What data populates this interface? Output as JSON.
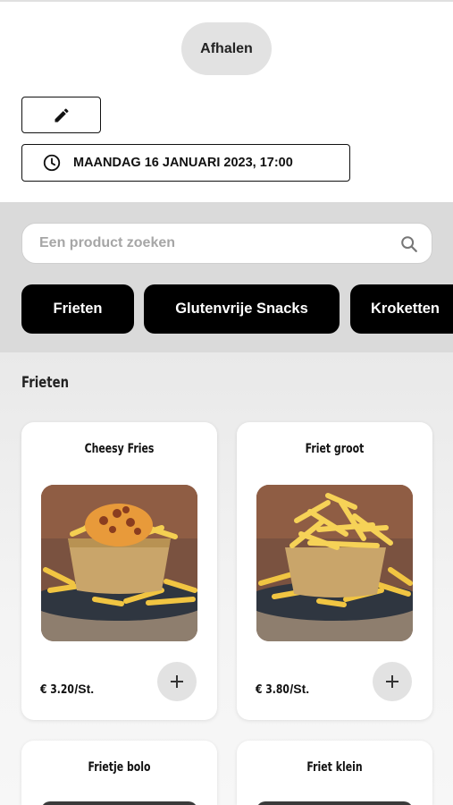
{
  "header": {
    "order_type": "Afhalen",
    "edit_icon": "pencil-icon",
    "datetime": "MAANDAG 16 JANUARI 2023, 17:00",
    "datetime_icon": "clock-icon"
  },
  "search": {
    "placeholder": "Een product zoeken",
    "icon": "search-icon"
  },
  "categories": [
    {
      "label": "Frieten"
    },
    {
      "label": "Glutenvrije Snacks"
    },
    {
      "label": "Kroketten"
    }
  ],
  "section": {
    "title": "Frieten"
  },
  "products": [
    {
      "name": "Cheesy Fries",
      "price": "€ 3.20",
      "unit": "/St."
    },
    {
      "name": "Friet groot",
      "price": "€ 3.80",
      "unit": "/St."
    },
    {
      "name": "Frietje bolo",
      "price": "",
      "unit": ""
    },
    {
      "name": "Friet klein",
      "price": "",
      "unit": ""
    }
  ],
  "colors": {
    "chip_bg": "#000000",
    "band_bg": "#dadada",
    "pill_bg": "#e2e2e2"
  }
}
